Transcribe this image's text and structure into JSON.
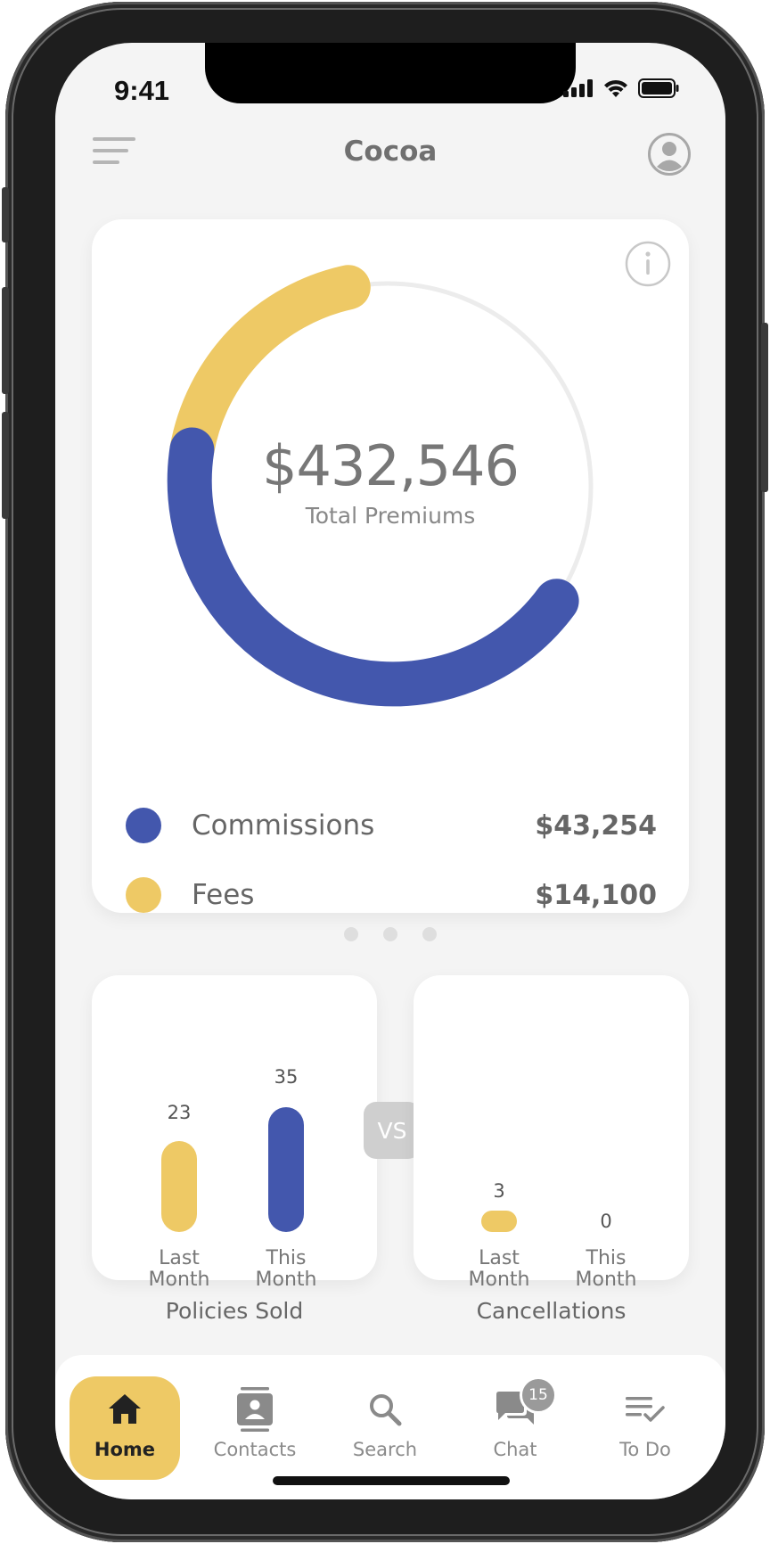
{
  "status": {
    "time": "9:41"
  },
  "header": {
    "title": "Cocoa"
  },
  "premiums": {
    "total": "$432,546",
    "label": "Total Premiums",
    "legend": [
      {
        "label": "Commissions",
        "value": "$43,254",
        "color": "#4357ad"
      },
      {
        "label": "Fees",
        "value": "$14,100",
        "color": "#eec965"
      }
    ]
  },
  "policies": {
    "caption": "Policies Sold",
    "bars": [
      {
        "value": "23",
        "label_line1": "Last",
        "label_line2": "Month"
      },
      {
        "value": "35",
        "label_line1": "This",
        "label_line2": "Month"
      }
    ]
  },
  "vs_label": "VS",
  "cancellations": {
    "caption": "Cancellations",
    "bars": [
      {
        "value": "3",
        "label_line1": "Last",
        "label_line2": "Month"
      },
      {
        "value": "0",
        "label_line1": "This",
        "label_line2": "Month"
      }
    ]
  },
  "tabs": [
    {
      "label": "Home",
      "icon": "home-icon"
    },
    {
      "label": "Contacts",
      "icon": "contacts-icon"
    },
    {
      "label": "Search",
      "icon": "search-icon"
    },
    {
      "label": "Chat",
      "icon": "chat-icon",
      "badge": "15"
    },
    {
      "label": "To Do",
      "icon": "todo-icon"
    }
  ],
  "colors": {
    "accent_blue": "#4357ad",
    "accent_yellow": "#eec965",
    "track": "#ececec"
  }
}
